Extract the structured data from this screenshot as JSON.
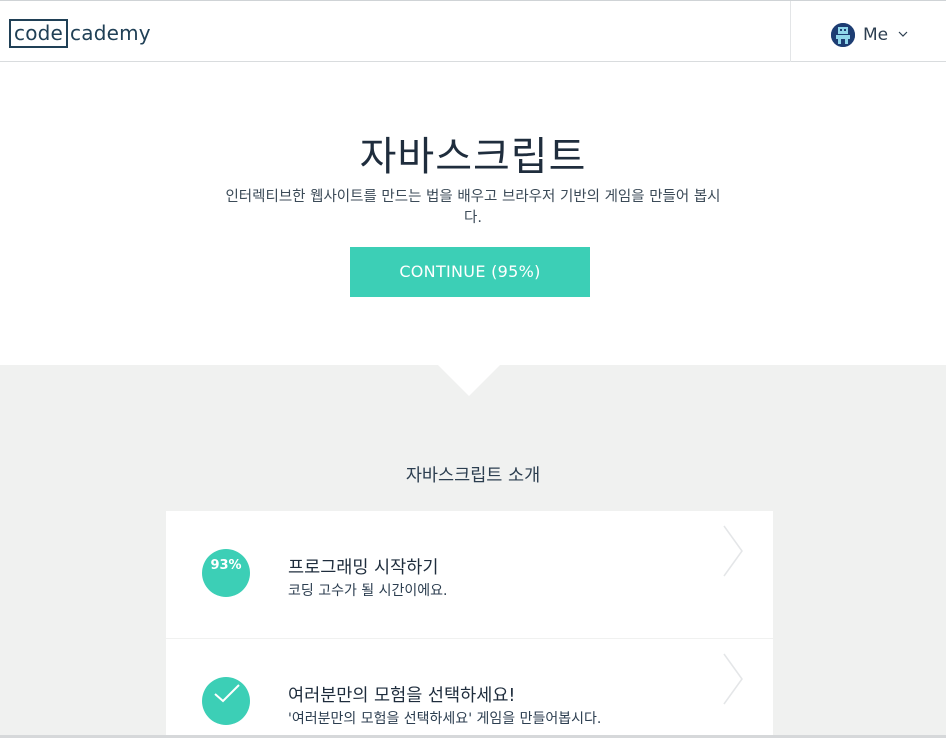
{
  "header": {
    "logo": {
      "part1": "code",
      "part2": "cademy"
    },
    "user": {
      "label": "Me",
      "avatar_icon": "user-avatar-icon",
      "dropdown_icon": "chevron-down-icon"
    }
  },
  "hero": {
    "title": "자바스크립트",
    "description": "인터렉티브한 웹사이트를 만드는 법을 배우고 브라우저 기반의 게임을 만들어 봅시다.",
    "continue_label": "CONTINUE (95%)"
  },
  "section": {
    "title": "자바스크립트 소개",
    "units": [
      {
        "progress_text": "93%",
        "title": "프로그래밍 시작하기",
        "subtitle": "코딩 고수가 될 시간이에요."
      },
      {
        "status_icon": "checkmark-icon",
        "title": "여러분만의 모험을 선택하세요!",
        "subtitle": "'여러분만의 모험을 선택하세요' 게임을 만들어봅시다."
      }
    ]
  },
  "colors": {
    "accent": "#3ccfb6",
    "brand": "#204056",
    "section_bg": "#f0f1f0"
  }
}
